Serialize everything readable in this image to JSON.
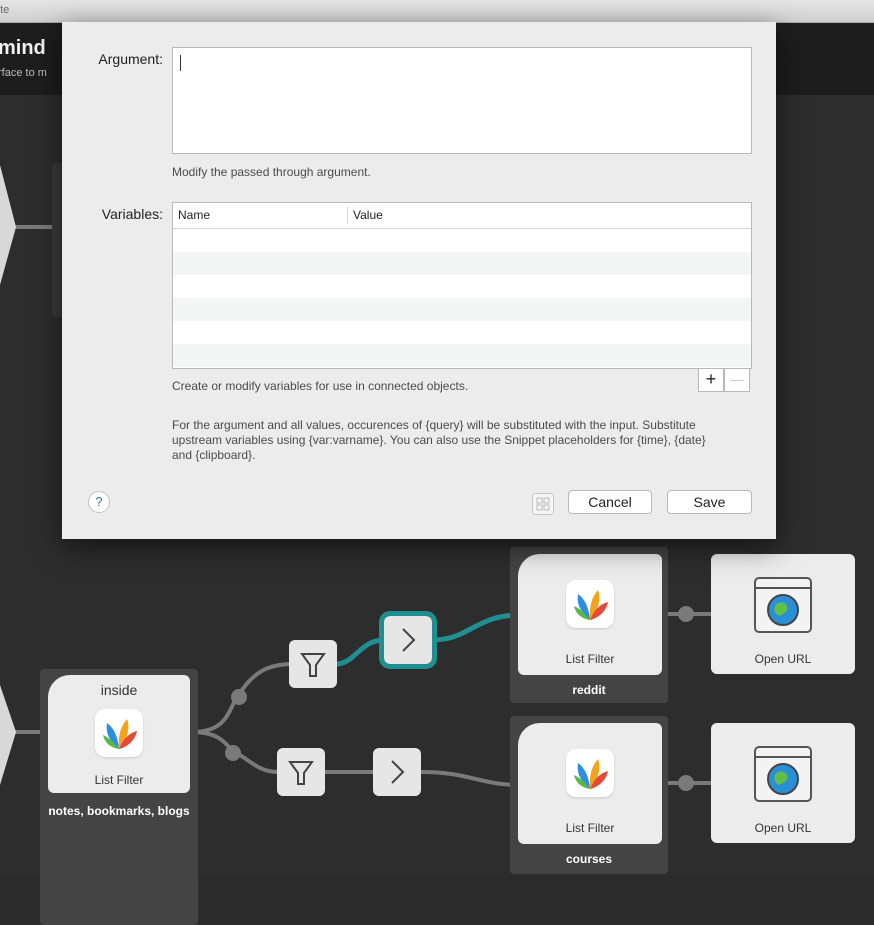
{
  "window": {
    "title_fragment": "ote"
  },
  "header": {
    "workflow_name": "mind",
    "workflow_desc": "rface to m"
  },
  "dialog": {
    "argument_label": "Argument:",
    "argument_value": "",
    "argument_help": "Modify the passed through argument.",
    "variables_label": "Variables:",
    "variables_columns": [
      "Name",
      "Value"
    ],
    "variables_rows": [],
    "variables_help": "Create or modify variables for use in connected objects.",
    "add_label": "+",
    "remove_label": "—",
    "info_text": "For the argument and all values, occurences of {query} will be substituted with the input. Substitute upstream variables using {var:varname}. You can also use the Snippet placeholders for {time}, {date} and {clipboard}.",
    "help_label": "?",
    "cancel_label": "Cancel",
    "save_label": "Save"
  },
  "workflow": {
    "main_group": {
      "keyword": "inside",
      "title": "List Filter",
      "label": "notes, bookmarks, blogs"
    },
    "reddit_group": {
      "title": "List Filter",
      "label": "reddit"
    },
    "courses_group": {
      "title": "List Filter",
      "label": "courses"
    },
    "open_url_1": {
      "title": "Open URL"
    },
    "open_url_2": {
      "title": "Open URL"
    }
  },
  "colors": {
    "selected_connection": "#1f8f92",
    "connection": "#7a7a7a",
    "canvas": "#2d2d2d"
  }
}
